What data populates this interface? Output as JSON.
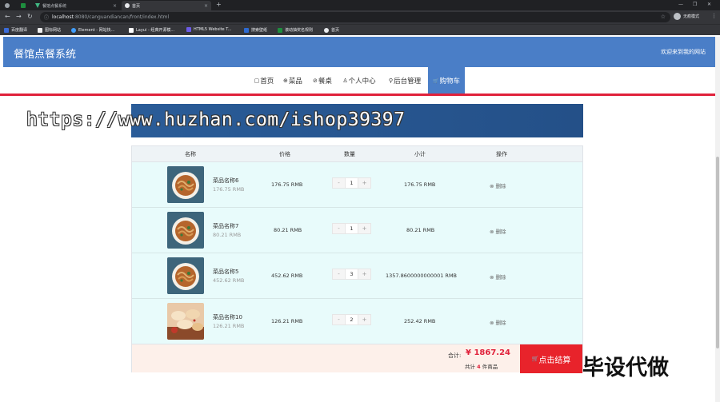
{
  "browser": {
    "tabs": [
      {
        "title": ""
      },
      {
        "title": "餐馆点餐系统"
      },
      {
        "title": "首页"
      }
    ],
    "new_tab": "+",
    "url_host": "localhost",
    "url_rest": ":8080/canguandiancan/front/index.html",
    "profile_label": "无痕模式",
    "bookmarks": [
      {
        "label": "百度翻译",
        "color": "#3b6bd8"
      },
      {
        "label": "图标网站",
        "color": "#eeeeee"
      },
      {
        "label": "Element - 网站快...",
        "color": "#409eff"
      },
      {
        "label": "Layui - 经典开源模...",
        "color": "#ffffff"
      },
      {
        "label": "HTML5 Website T...",
        "color": "#6c5ce7"
      },
      {
        "label": "搜索壁纸",
        "color": "#2d6ad1"
      },
      {
        "label": "滚动抽奖名规则",
        "color": "#1e8e3e"
      },
      {
        "label": "首页",
        "color": "#e8eaed"
      }
    ]
  },
  "site": {
    "title": "餐馆点餐系统",
    "welcome": "欢迎来到我的网站",
    "menu": [
      {
        "icon": "▢",
        "label": "首页",
        "active": false
      },
      {
        "icon": "⊕",
        "label": "菜品",
        "active": false
      },
      {
        "icon": "⊘",
        "label": "餐桌",
        "active": false
      },
      {
        "icon": "♙",
        "label": "个人中心",
        "active": false
      },
      {
        "icon": "⚲",
        "label": "后台管理",
        "active": false
      },
      {
        "icon": "🛒",
        "label": "购物车",
        "active": true
      }
    ]
  },
  "cart": {
    "headers": {
      "name": "名称",
      "price": "价格",
      "qty": "数量",
      "subtotal": "小计",
      "action": "操作"
    },
    "items": [
      {
        "name": "菜品名称6",
        "sub_price": "176.75 RMB",
        "price": "176.75 RMB",
        "qty": "1",
        "subtotal": "176.75 RMB",
        "delete": "删除",
        "image": "noodle-bowl"
      },
      {
        "name": "菜品名称7",
        "sub_price": "80.21 RMB",
        "price": "80.21 RMB",
        "qty": "1",
        "subtotal": "80.21 RMB",
        "delete": "删除",
        "image": "noodle-bowl"
      },
      {
        "name": "菜品名称5",
        "sub_price": "452.62 RMB",
        "price": "452.62 RMB",
        "qty": "3",
        "subtotal": "1357.8600000000001 RMB",
        "delete": "删除",
        "image": "noodle-bowl"
      },
      {
        "name": "菜品名称10",
        "sub_price": "126.21 RMB",
        "price": "126.21 RMB",
        "qty": "2",
        "subtotal": "252.42 RMB",
        "delete": "删除",
        "image": "dumplings"
      }
    ],
    "total_label": "合计:",
    "total_value": "¥ 1867.24",
    "count_prefix": "共计",
    "count_value": "4",
    "count_suffix": "件商品",
    "checkout_label": "点击结算"
  },
  "overlay": {
    "watermark_url": "https://www.huzhan.com/ishop39397",
    "watermark_text": "毕设代做"
  }
}
